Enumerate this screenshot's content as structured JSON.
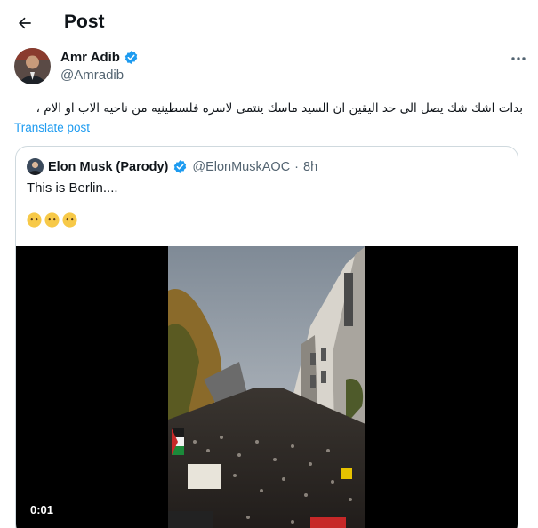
{
  "header": {
    "title": "Post",
    "back_icon": "arrow-left-icon"
  },
  "post": {
    "author_name": "Amr Adib",
    "author_handle": "@Amradib",
    "verified": true,
    "text": "بدات اشك شك يصل الى حد اليقين ان السيد ماسك ينتمى لاسره فلسطينيه من ناحيه الاب او الام ،",
    "translate_label": "Translate post",
    "more_icon": "more-icon"
  },
  "quoted_post": {
    "author_name": "Elon Musk (Parody)",
    "author_handle": "@ElonMuskAOC",
    "separator": "·",
    "time": "8h",
    "verified": true,
    "text": "This is Berlin....",
    "emojis": [
      "face-without-mouth",
      "face-without-mouth",
      "face-without-mouth"
    ],
    "video_duration": "0:01"
  },
  "colors": {
    "accent": "#1d9bf0",
    "text_primary": "#0f1419",
    "text_secondary": "#536471",
    "border": "#cfd9de"
  }
}
